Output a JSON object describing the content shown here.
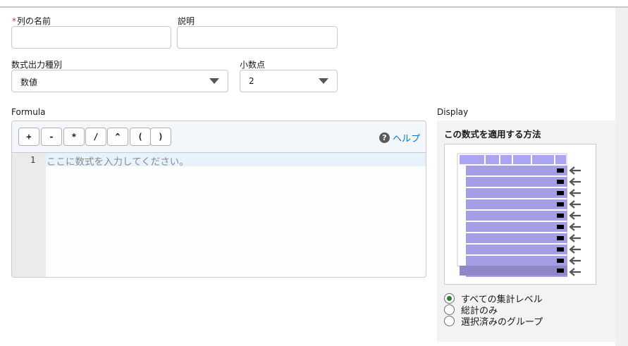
{
  "form": {
    "column_name_label": "列の名前",
    "required_mark": "*",
    "column_name_value": "",
    "description_label": "説明",
    "description_value": "",
    "output_type_label": "数式出力種別",
    "output_type_value": "数値",
    "decimals_label": "小数点",
    "decimals_value": "2"
  },
  "formula": {
    "label": "Formula",
    "operators": [
      "+",
      "-",
      "*",
      "/",
      "^",
      "(",
      ")"
    ],
    "help_label": "ヘルプ",
    "help_icon": "question-circle-icon",
    "line_number": "1",
    "placeholder": "ここに数式を入力してください。"
  },
  "display": {
    "label": "Display",
    "title": "この数式を適用する方法",
    "preview_icon": "summary-levels-diagram",
    "options": [
      {
        "label": "すべての集計レベル",
        "selected": true
      },
      {
        "label": "総計のみ",
        "selected": false
      },
      {
        "label": "選択済みのグループ",
        "selected": false
      }
    ],
    "colors": {
      "header": "#a9a5ee",
      "row": "#a49fe4",
      "total": "#8f88c8",
      "radio_selected": "#2e7d32",
      "link": "#0176d3"
    }
  }
}
